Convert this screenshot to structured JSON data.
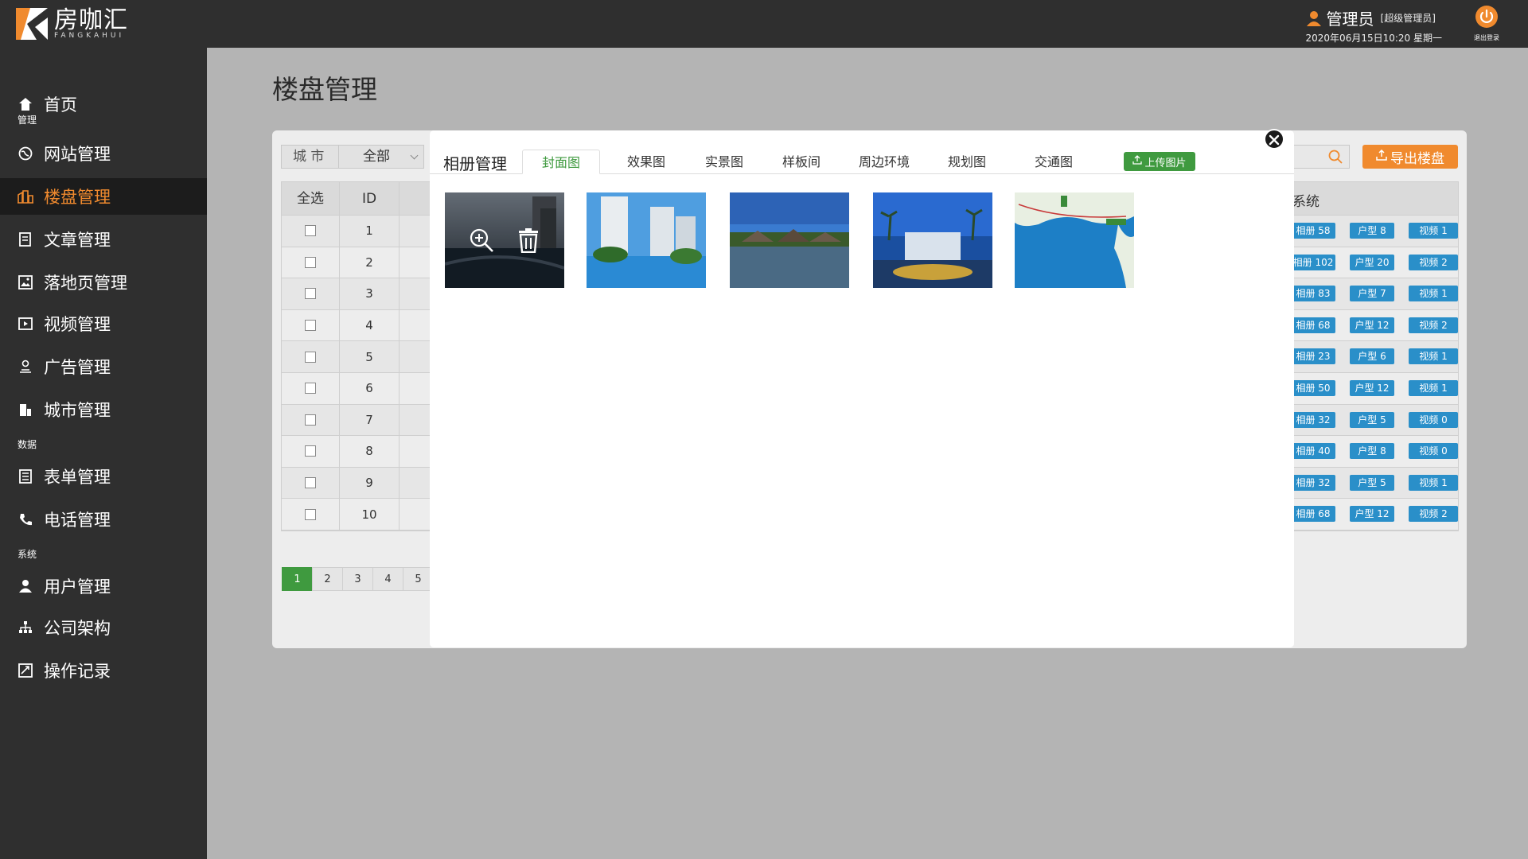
{
  "header": {
    "logo_cn": "房咖汇",
    "logo_en": "FANGKAHUI",
    "user_name": "管理员",
    "user_role": "[超级管理员]",
    "datetime": "2020年06月15日10:20 星期一",
    "logout_label": "退出登录"
  },
  "sidebar": {
    "home": "首页",
    "group_manage": "管理",
    "items_manage": [
      "网站管理",
      "楼盘管理",
      "文章管理",
      "落地页管理",
      "视频管理",
      "广告管理",
      "城市管理"
    ],
    "group_data": "数据",
    "items_data": [
      "表单管理",
      "电话管理"
    ],
    "group_system": "系统",
    "items_system": [
      "用户管理",
      "公司架构",
      "操作记录"
    ],
    "active": "楼盘管理"
  },
  "main": {
    "title": "楼盘管理",
    "filter_label": "城 市",
    "filter_value": "全部",
    "export_label": "导出楼盘",
    "col_select_all": "全选",
    "col_id": "ID",
    "col_system": "系统",
    "rows": [
      {
        "id": "1",
        "album": "相册 58",
        "huxing": "户型 8",
        "video": "视频 1"
      },
      {
        "id": "2",
        "album": "相册 102",
        "huxing": "户型 20",
        "video": "视频 2"
      },
      {
        "id": "3",
        "album": "相册 83",
        "huxing": "户型 7",
        "video": "视频 1"
      },
      {
        "id": "4",
        "album": "相册 68",
        "huxing": "户型 12",
        "video": "视频 2"
      },
      {
        "id": "5",
        "album": "相册 23",
        "huxing": "户型 6",
        "video": "视频 1"
      },
      {
        "id": "6",
        "album": "相册 50",
        "huxing": "户型 12",
        "video": "视频 1"
      },
      {
        "id": "7",
        "album": "相册 32",
        "huxing": "户型 5",
        "video": "视频 0"
      },
      {
        "id": "8",
        "album": "相册 40",
        "huxing": "户型 8",
        "video": "视频 0"
      },
      {
        "id": "9",
        "album": "相册 32",
        "huxing": "户型 5",
        "video": "视频 1"
      },
      {
        "id": "10",
        "album": "相册 68",
        "huxing": "户型 12",
        "video": "视频 2"
      }
    ],
    "pages": [
      "1",
      "2",
      "3",
      "4",
      "5"
    ],
    "current_page": "1"
  },
  "modal": {
    "title": "相册管理",
    "tabs": [
      "封面图",
      "效果图",
      "实景图",
      "样板间",
      "周边环境",
      "规划图",
      "交通图"
    ],
    "active_tab": "封面图",
    "upload_label": "上传图片"
  },
  "colors": {
    "accent": "#f08a2e",
    "green": "#3f9a3f",
    "tag_blue": "#2a8fc9",
    "dark": "#2f2f2f"
  }
}
